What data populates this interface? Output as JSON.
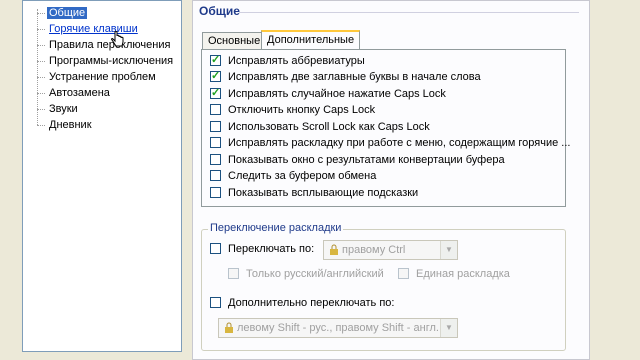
{
  "tree": {
    "items": [
      "Общие",
      "Горячие клавиши",
      "Правила переключения",
      "Программы-исключения",
      "Устранение проблем",
      "Автозамена",
      "Звуки",
      "Дневник"
    ]
  },
  "panel": {
    "title": "Общие",
    "tabs": [
      "Основные",
      "Дополнительные"
    ],
    "options": [
      {
        "label": "Исправлять аббревиатуры",
        "checked": true
      },
      {
        "label": "Исправлять две заглавные буквы в начале слова",
        "checked": true
      },
      {
        "label": "Исправлять случайное нажатие Caps Lock",
        "checked": true
      },
      {
        "label": "Отключить кнопку Caps Lock",
        "checked": false
      },
      {
        "label": "Использовать Scroll Lock как Caps Lock",
        "checked": false
      },
      {
        "label": "Исправлять раскладку при работе с меню, содержащим горячие ...",
        "checked": false
      },
      {
        "label": "Показывать окно с результатами конвертации буфера",
        "checked": false
      },
      {
        "label": "Следить за буфером обмена",
        "checked": false
      },
      {
        "label": "Показывать всплывающие подсказки",
        "checked": false
      }
    ],
    "layout_group": {
      "title": "Переключение раскладки",
      "switch_label": "Переключать по:",
      "switch_combo": "правому Ctrl",
      "only_ru_en": "Только русский/английский",
      "single_layout": "Единая раскладка",
      "extra_label": "Дополнительно переключать по:",
      "extra_combo": "левому Shift - рус., правому Shift - англ."
    }
  },
  "colors": {
    "selection": "#316ac5",
    "accent_title": "#1f3a8a",
    "tab_highlight": "#ffc83c",
    "check": "#21a121"
  }
}
